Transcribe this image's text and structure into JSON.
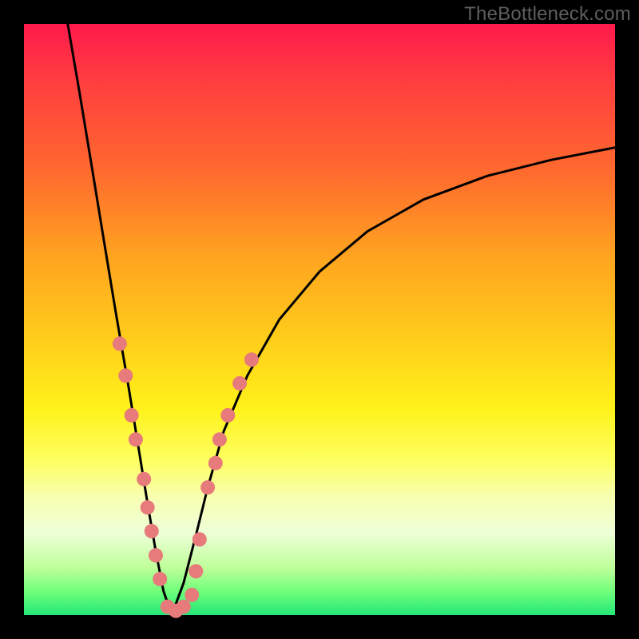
{
  "watermark": "TheBottleneck.com",
  "colors": {
    "frame": "#000000",
    "curve": "#000000",
    "dot": "#e77a7a",
    "gradient_top": "#ff1a4b",
    "gradient_bottom": "#23e778"
  },
  "chart_data": {
    "type": "line",
    "title": "",
    "xlabel": "",
    "ylabel": "",
    "xlim": [
      0,
      100
    ],
    "ylim": [
      0,
      100
    ],
    "grid": false,
    "legend": false,
    "notes": "V-shaped bottleneck curve on rainbow gradient; axes unlabeled; values estimated from pixel positions (plot-area-relative percentages).",
    "series": [
      {
        "name": "curve-left",
        "x": [
          7.4,
          9.5,
          11.5,
          13.5,
          15.5,
          17.6,
          19.6,
          20.9,
          22.3,
          23.6,
          25.0
        ],
        "y": [
          100.0,
          87.8,
          75.7,
          63.5,
          51.4,
          39.2,
          27.0,
          18.9,
          10.8,
          4.1,
          0.0
        ]
      },
      {
        "name": "curve-right",
        "x": [
          25.0,
          27.0,
          29.1,
          31.1,
          33.8,
          37.8,
          43.2,
          50.0,
          58.1,
          67.6,
          78.4,
          89.2,
          100.0
        ],
        "y": [
          0.0,
          5.4,
          13.5,
          21.6,
          31.1,
          40.5,
          50.0,
          58.1,
          64.9,
          70.3,
          74.3,
          77.0,
          79.1
        ]
      }
    ],
    "dots": {
      "name": "highlight-dots",
      "points": [
        {
          "x": 16.2,
          "y": 45.9
        },
        {
          "x": 17.2,
          "y": 40.5
        },
        {
          "x": 18.2,
          "y": 33.8
        },
        {
          "x": 18.9,
          "y": 29.7
        },
        {
          "x": 20.3,
          "y": 23.0
        },
        {
          "x": 20.9,
          "y": 18.2
        },
        {
          "x": 21.6,
          "y": 14.2
        },
        {
          "x": 22.3,
          "y": 10.1
        },
        {
          "x": 23.0,
          "y": 6.1
        },
        {
          "x": 24.3,
          "y": 1.4
        },
        {
          "x": 25.7,
          "y": 0.7
        },
        {
          "x": 27.0,
          "y": 1.4
        },
        {
          "x": 28.4,
          "y": 3.4
        },
        {
          "x": 29.1,
          "y": 7.4
        },
        {
          "x": 29.7,
          "y": 12.8
        },
        {
          "x": 31.1,
          "y": 21.6
        },
        {
          "x": 32.4,
          "y": 25.7
        },
        {
          "x": 33.1,
          "y": 29.7
        },
        {
          "x": 34.5,
          "y": 33.8
        },
        {
          "x": 36.5,
          "y": 39.2
        },
        {
          "x": 38.5,
          "y": 43.2
        }
      ]
    }
  }
}
